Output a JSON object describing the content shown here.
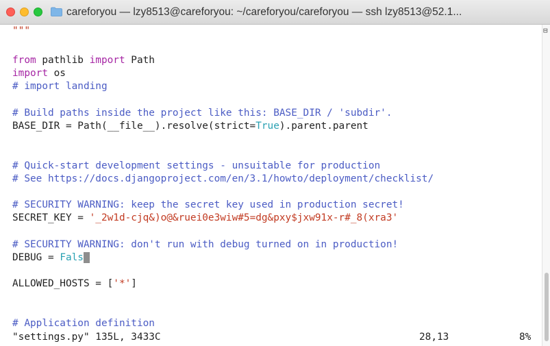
{
  "window": {
    "title": "careforyou — lzy8513@careforyou: ~/careforyou/careforyou — ssh lzy8513@52.1..."
  },
  "editor": {
    "l1": "\"\"\"",
    "l2_kw1": "from",
    "l2_mod": " pathlib ",
    "l2_kw2": "import",
    "l2_rest": " Path",
    "l3_kw": "import",
    "l3_rest": " os",
    "l4": "# import landing",
    "l6": "# Build paths inside the project like this: BASE_DIR / 'subdir'.",
    "l7_a": "BASE_DIR = Path(__file__).resolve(strict=",
    "l7_b": "True",
    "l7_c": ").parent.parent",
    "l10": "# Quick-start development settings - unsuitable for production",
    "l11": "# See https://docs.djangoproject.com/en/3.1/howto/deployment/checklist/",
    "l13": "# SECURITY WARNING: keep the secret key used in production secret!",
    "l14_a": "SECRET_KEY = ",
    "l14_b": "'_2w1d-cjq&)o@&ruei0e3wiw#5=dg&pxy$jxw91x-r#_8(xra3'",
    "l16": "# SECURITY WARNING: don't run with debug turned on in production!",
    "l17_a": "DEBUG = ",
    "l17_b": "Fals",
    "l17_cursor": " ",
    "l19_a": "ALLOWED_HOSTS = [",
    "l19_b": "'*'",
    "l19_c": "]",
    "l22": "# Application definition"
  },
  "statusline": {
    "file": "\"settings.py\" 135L, 3433C",
    "position": "28,13",
    "percent": "8%"
  },
  "colors": {
    "keyword": "#a626a4",
    "comment": "#4b5cc4",
    "string": "#c23b22",
    "builtin": "#2aa1b3"
  },
  "icons": {
    "folder": "folder-icon",
    "scrollbar_glyph": "scroll-marker-icon"
  }
}
